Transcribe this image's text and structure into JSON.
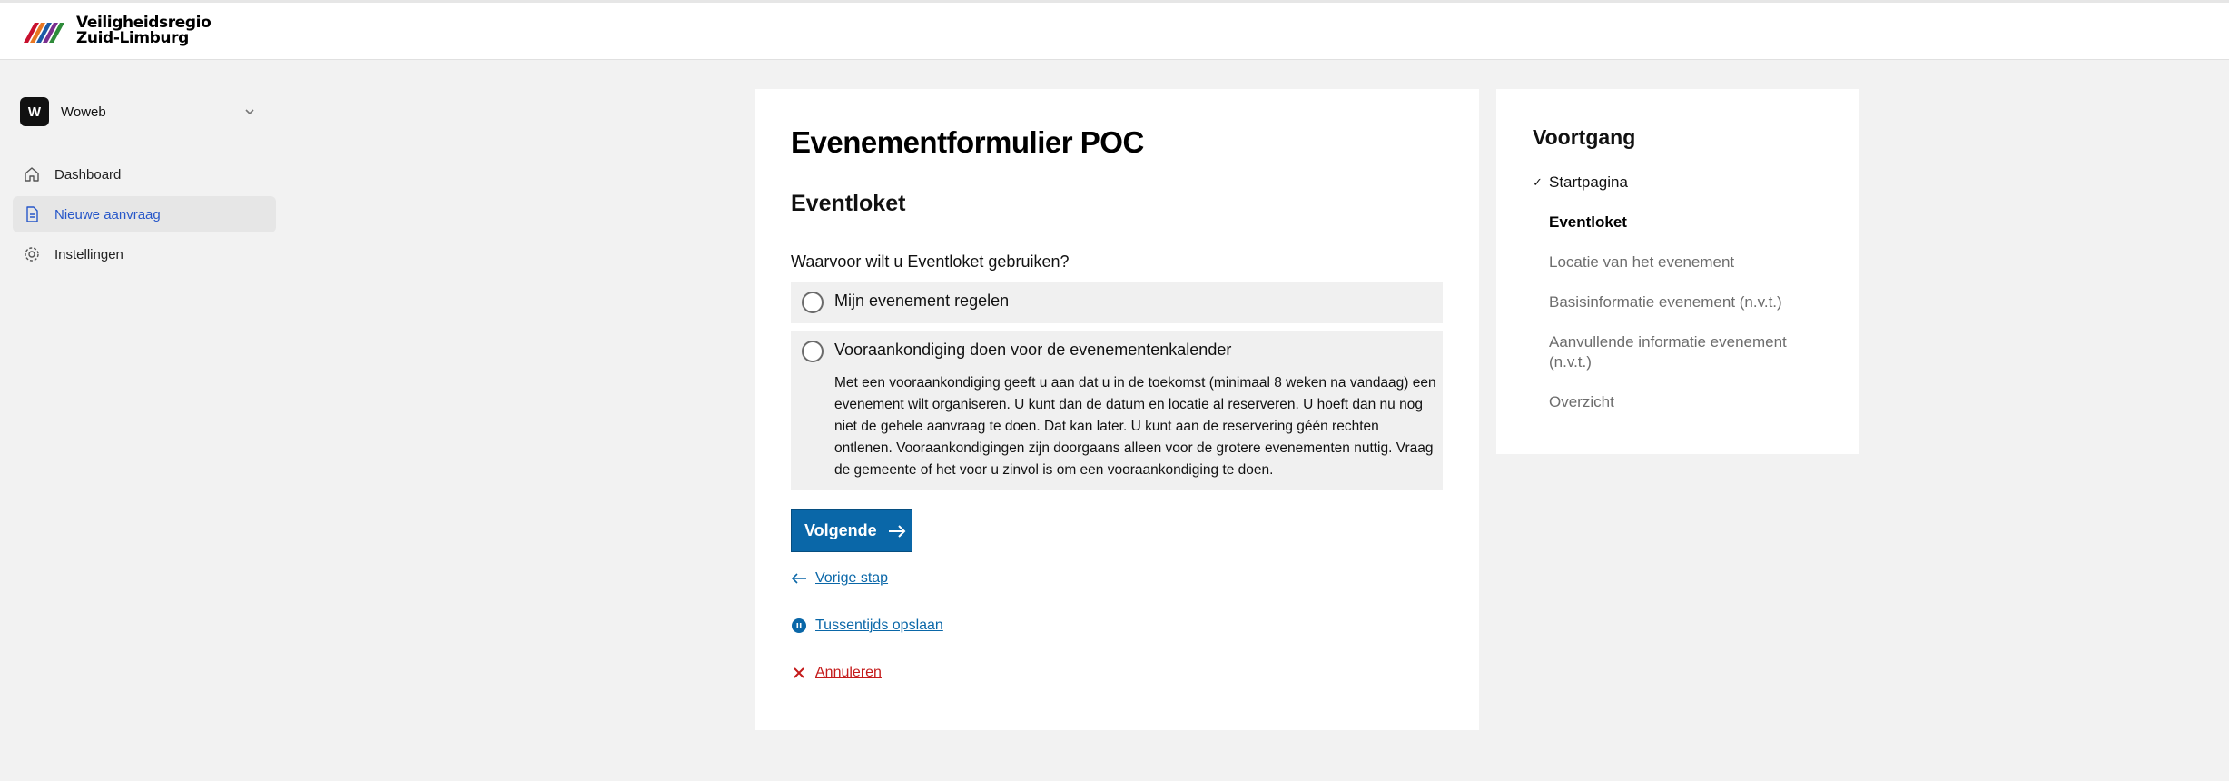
{
  "header": {
    "logo_line1": "Veiligheidsregio",
    "logo_line2": "Zuid-Limburg"
  },
  "sidebar": {
    "org_initial": "W",
    "org_name": "Woweb",
    "items": [
      {
        "label": "Dashboard",
        "icon": "home-icon",
        "active": false
      },
      {
        "label": "Nieuwe aanvraag",
        "icon": "document-icon",
        "active": true
      },
      {
        "label": "Instellingen",
        "icon": "gear-icon",
        "active": false
      }
    ]
  },
  "form": {
    "title": "Evenementformulier POC",
    "section": "Eventloket",
    "question": "Waarvoor wilt u Eventloket gebruiken?",
    "options": [
      {
        "label": "Mijn evenement regelen",
        "selected": false
      },
      {
        "label": "Vooraankondiging doen voor de evenementenkalender",
        "selected": false,
        "description": "Met een vooraankondiging geeft u aan dat u in de toekomst (minimaal 8 weken na vandaag) een evenement wilt organiseren. U kunt dan de datum en locatie al reserveren. U hoeft dan nu nog niet de gehele aanvraag te doen. Dat kan later. U kunt aan de reservering géén rechten ontlenen. Vooraankondigingen zijn doorgaans alleen voor de grotere evenementen nuttig. Vraag de gemeente of het voor u zinvol is om een vooraankondiging te doen."
      }
    ],
    "next_label": "Volgende",
    "prev_label": "Vorige stap",
    "save_label": "Tussentijds opslaan",
    "cancel_label": "Annuleren"
  },
  "progress": {
    "title": "Voortgang",
    "steps": [
      {
        "label": "Startpagina",
        "state": "done"
      },
      {
        "label": "Eventloket",
        "state": "current"
      },
      {
        "label": "Locatie van het evenement",
        "state": "todo"
      },
      {
        "label": "Basisinformatie evenement (n.v.t.)",
        "state": "todo"
      },
      {
        "label": "Aanvullende informatie evenement (n.v.t.)",
        "state": "todo"
      },
      {
        "label": "Overzicht",
        "state": "todo"
      }
    ]
  },
  "colors": {
    "primary": "#0a67a8",
    "danger": "#c41a1a",
    "active_nav_text": "#2757c9",
    "background": "#f2f2f2"
  }
}
